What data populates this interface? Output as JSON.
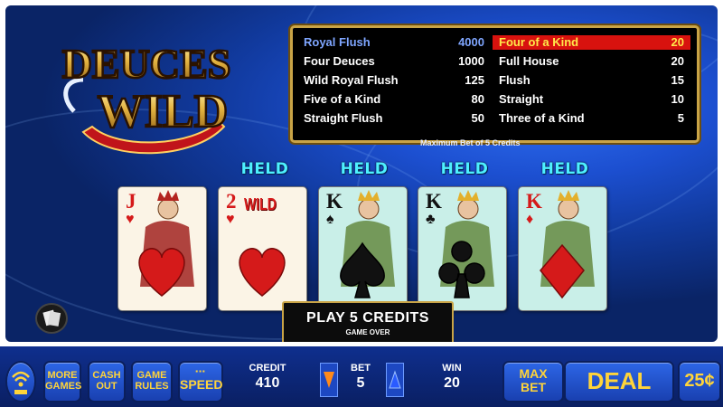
{
  "logo": {
    "line1": "DEUCES",
    "line2": "WILD"
  },
  "paytable": {
    "left": [
      {
        "name": "Royal Flush",
        "value": "4000",
        "highlight": true
      },
      {
        "name": "Four Deuces",
        "value": "1000"
      },
      {
        "name": "Wild Royal Flush",
        "value": "125"
      },
      {
        "name": "Five of a Kind",
        "value": "80"
      },
      {
        "name": "Straight Flush",
        "value": "50"
      }
    ],
    "right": [
      {
        "name": "Four of a Kind",
        "value": "20",
        "highlight": true
      },
      {
        "name": "Full House",
        "value": "20"
      },
      {
        "name": "Flush",
        "value": "15"
      },
      {
        "name": "Straight",
        "value": "10"
      },
      {
        "name": "Three of a Kind",
        "value": "5"
      }
    ],
    "max_bet_note": "Maximum Bet of 5 Credits"
  },
  "cards": [
    {
      "rank": "J",
      "suit": "hearts",
      "held": false,
      "held_label": ""
    },
    {
      "rank": "2",
      "suit": "hearts",
      "held": true,
      "held_label": "HELD",
      "wild_text": "WILD"
    },
    {
      "rank": "K",
      "suit": "spades",
      "held": true,
      "held_label": "HELD"
    },
    {
      "rank": "K",
      "suit": "clubs",
      "held": true,
      "held_label": "HELD"
    },
    {
      "rank": "K",
      "suit": "diamonds",
      "held": true,
      "held_label": "HELD"
    }
  ],
  "status": {
    "play_line": "PLAY 5 CREDITS",
    "game_over": "GAME OVER"
  },
  "bottom": {
    "more_games": [
      "MORE",
      "GAMES"
    ],
    "cash_out": [
      "CASH",
      "OUT"
    ],
    "game_rules": [
      "GAME",
      "RULES"
    ],
    "speed": "SPEED",
    "credit_label": "CREDIT",
    "credit_value": "410",
    "bet_label": "BET",
    "bet_value": "5",
    "win_label": "WIN",
    "win_value": "20",
    "max_bet": [
      "MAX",
      "BET"
    ],
    "deal": "DEAL",
    "denomination": "25¢"
  },
  "colors": {
    "gold": "#c9a447",
    "held_cyan": "#4df0ff",
    "button_text": "#ffd43a",
    "highlight_red": "#d8120e"
  }
}
